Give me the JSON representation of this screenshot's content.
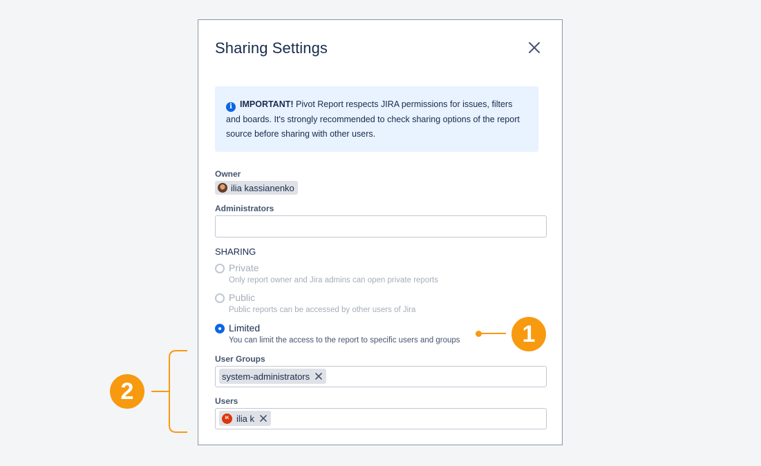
{
  "dialog": {
    "title": "Sharing Settings",
    "close_icon": "close-icon",
    "info": {
      "icon": "info-icon",
      "icon_glyph": "i",
      "strong": "IMPORTANT!",
      "text": " Pivot Report respects JIRA permissions for issues, filters and boards. It's strongly recommended to check sharing options of the report source before sharing with other users."
    },
    "owner": {
      "label": "Owner",
      "name": "ilia kassianenko"
    },
    "administrators": {
      "label": "Administrators",
      "value": ""
    },
    "sharing": {
      "title": "SHARING",
      "selected": "Limited",
      "options": [
        {
          "label": "Private",
          "description": "Only report owner and Jira admins can open private reports",
          "disabled": true
        },
        {
          "label": "Public",
          "description": "Public reports can be accessed by other users of Jira",
          "disabled": true
        },
        {
          "label": "Limited",
          "description": "You can limit the access to the report to specific users and groups",
          "disabled": false
        }
      ]
    },
    "user_groups": {
      "label": "User Groups",
      "tags": [
        "system-administrators"
      ]
    },
    "users": {
      "label": "Users",
      "tags": [
        {
          "initials": "IK",
          "name": "ilia k"
        }
      ]
    }
  },
  "annotations": [
    {
      "number": "1"
    },
    {
      "number": "2"
    }
  ],
  "colors": {
    "accent": "#0c66e4",
    "callout": "#f79a0f",
    "info_background": "#e9f2ff",
    "avatar_initials_bg": "#de350b"
  }
}
